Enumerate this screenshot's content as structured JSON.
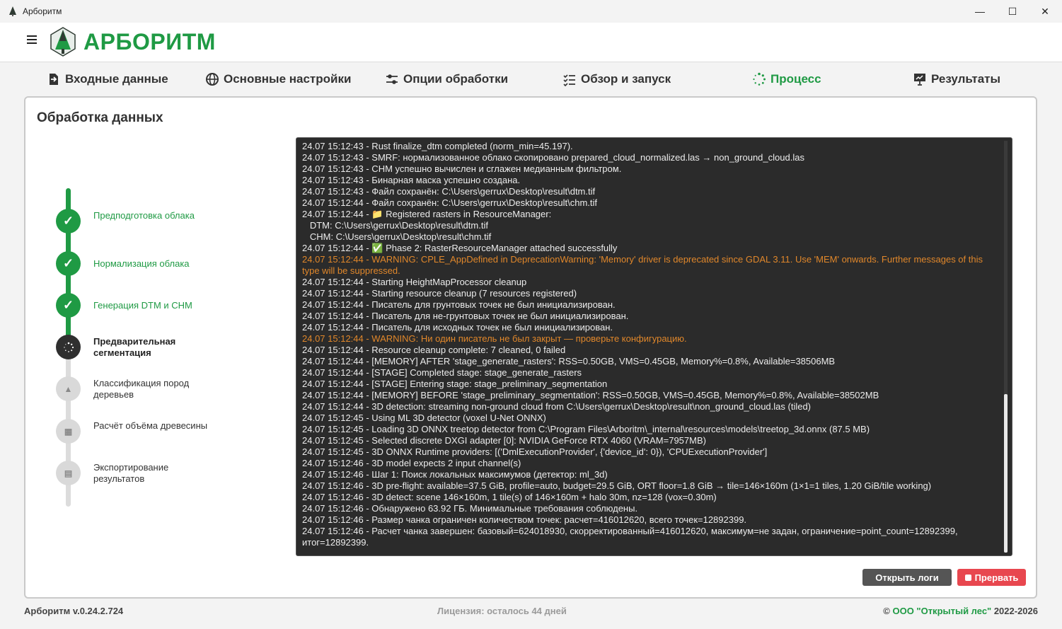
{
  "window": {
    "title": "Арборитм",
    "minimize": "—",
    "maximize": "☐",
    "close": "✕"
  },
  "header": {
    "brand": "АРБОРИТМ"
  },
  "tabs": [
    {
      "label": "Входные данные",
      "icon": "file-import-icon"
    },
    {
      "label": "Основные настройки",
      "icon": "globe-icon"
    },
    {
      "label": "Опции обработки",
      "icon": "sliders-icon"
    },
    {
      "label": "Обзор и запуск",
      "icon": "checklist-icon"
    },
    {
      "label": "Процесс",
      "icon": "spinner-icon",
      "active": true
    },
    {
      "label": "Результаты",
      "icon": "presentation-icon"
    }
  ],
  "panel": {
    "title": "Обработка данных"
  },
  "steps": [
    {
      "label": "Предподготовка облака",
      "state": "done",
      "symbol": "✓"
    },
    {
      "label": "Нормализация облака",
      "state": "done",
      "symbol": "✓"
    },
    {
      "label": "Генерация DTM и CHM",
      "state": "done",
      "symbol": "✓"
    },
    {
      "label": "Предварительная сегментация",
      "state": "current",
      "symbol": ""
    },
    {
      "label": "Классификация пород деревьев",
      "state": "pending",
      "symbol": "▲"
    },
    {
      "label": "Расчёт объёма древесины",
      "state": "pending",
      "symbol": "▦"
    },
    {
      "label": "Экспортирование результатов",
      "state": "pending",
      "symbol": "▤"
    }
  ],
  "log": {
    "lines": [
      {
        "text": "24.07 15:12:43 - Rust finalize_dtm completed (norm_min=45.197).",
        "level": "info"
      },
      {
        "text": "24.07 15:12:43 - SMRF: нормализованное облако скопировано prepared_cloud_normalized.las → non_ground_cloud.las",
        "level": "info"
      },
      {
        "text": "24.07 15:12:43 - CHM успешно вычислен и сглажен медианным фильтром.",
        "level": "info"
      },
      {
        "text": "24.07 15:12:43 - Бинарная маска успешно создана.",
        "level": "info"
      },
      {
        "text": "24.07 15:12:43 - Файл сохранён: C:\\Users\\gerrux\\Desktop\\result\\dtm.tif",
        "level": "info"
      },
      {
        "text": "24.07 15:12:44 - Файл сохранён: C:\\Users\\gerrux\\Desktop\\result\\chm.tif",
        "level": "info"
      },
      {
        "text": "24.07 15:12:44 - 📁 Registered rasters in ResourceManager:",
        "level": "info"
      },
      {
        "text": "   DTM: C:\\Users\\gerrux\\Desktop\\result\\dtm.tif",
        "level": "info"
      },
      {
        "text": "   CHM: C:\\Users\\gerrux\\Desktop\\result\\chm.tif",
        "level": "info"
      },
      {
        "text": "24.07 15:12:44 - ✅ Phase 2: RasterResourceManager attached successfully",
        "level": "info"
      },
      {
        "text": "24.07 15:12:44 - WARNING: CPLE_AppDefined in DeprecationWarning: 'Memory' driver is deprecated since GDAL 3.11. Use 'MEM' onwards. Further messages of this type will be suppressed.",
        "level": "warn"
      },
      {
        "text": "24.07 15:12:44 - Starting HeightMapProcessor cleanup",
        "level": "info"
      },
      {
        "text": "24.07 15:12:44 - Starting resource cleanup (7 resources registered)",
        "level": "info"
      },
      {
        "text": "24.07 15:12:44 - Писатель для грунтовых точек не был инициализирован.",
        "level": "info"
      },
      {
        "text": "24.07 15:12:44 - Писатель для не-грунтовых точек не был инициализирован.",
        "level": "info"
      },
      {
        "text": "24.07 15:12:44 - Писатель для исходных точек не был инициализирован.",
        "level": "info"
      },
      {
        "text": "24.07 15:12:44 - WARNING: Ни один писатель не был закрыт — проверьте конфигурацию.",
        "level": "warn"
      },
      {
        "text": "24.07 15:12:44 - Resource cleanup complete: 7 cleaned, 0 failed",
        "level": "info"
      },
      {
        "text": "24.07 15:12:44 - [MEMORY] AFTER 'stage_generate_rasters': RSS=0.50GB, VMS=0.45GB, Memory%=0.8%, Available=38506MB",
        "level": "info"
      },
      {
        "text": "24.07 15:12:44 - [STAGE] Completed stage: stage_generate_rasters",
        "level": "info"
      },
      {
        "text": "24.07 15:12:44 - [STAGE] Entering stage: stage_preliminary_segmentation",
        "level": "info"
      },
      {
        "text": "24.07 15:12:44 - [MEMORY] BEFORE 'stage_preliminary_segmentation': RSS=0.50GB, VMS=0.45GB, Memory%=0.8%, Available=38502MB",
        "level": "info"
      },
      {
        "text": "24.07 15:12:44 - 3D detection: streaming non-ground cloud from C:\\Users\\gerrux\\Desktop\\result\\non_ground_cloud.las (tiled)",
        "level": "info"
      },
      {
        "text": "24.07 15:12:45 - Using ML 3D detector (voxel U-Net ONNX)",
        "level": "info"
      },
      {
        "text": "24.07 15:12:45 - Loading 3D ONNX treetop detector from C:\\Program Files\\Arboritm\\_internal\\resources\\models\\treetop_3d.onnx (87.5 MB)",
        "level": "info"
      },
      {
        "text": "24.07 15:12:45 - Selected discrete DXGI adapter [0]: NVIDIA GeForce RTX 4060 (VRAM=7957MB)",
        "level": "info"
      },
      {
        "text": "24.07 15:12:45 - 3D ONNX Runtime providers: [('DmlExecutionProvider', {'device_id': 0}), 'CPUExecutionProvider']",
        "level": "info"
      },
      {
        "text": "24.07 15:12:46 - 3D model expects 2 input channel(s)",
        "level": "info"
      },
      {
        "text": "24.07 15:12:46 - Шаг 1: Поиск локальных максимумов (детектор: ml_3d)",
        "level": "info"
      },
      {
        "text": "24.07 15:12:46 - 3D pre-flight: available=37.5 GiB, profile=auto, budget=29.5 GiB, ORT floor=1.8 GiB → tile=146×160m (1×1=1 tiles, 1.20 GiB/tile working)",
        "level": "info"
      },
      {
        "text": "24.07 15:12:46 - 3D detect: scene 146×160m, 1 tile(s) of 146×160m + halo 30m, nz=128 (vox=0.30m)",
        "level": "info"
      },
      {
        "text": "24.07 15:12:46 - Обнаружено 63.92 ГБ. Минимальные требования соблюдены.",
        "level": "info"
      },
      {
        "text": "24.07 15:12:46 - Размер чанка ограничен количеством точек: расчет=416012620, всего точек=12892399.",
        "level": "info"
      },
      {
        "text": "24.07 15:12:46 - Расчет чанка завершен: базовый=624018930, скорректированный=416012620, максимум=не задан, ограничение=point_count=12892399, итог=12892399.",
        "level": "info"
      }
    ]
  },
  "buttons": {
    "open_logs": "Открыть логи",
    "stop": "Прервать"
  },
  "footer": {
    "version": "Арборитм v.0.24.2.724",
    "license": "Лицензия: осталось 44 дней",
    "copyright_prefix": "© ",
    "org": "ООО \"Открытый лес\"",
    "years": " 2022-2026"
  },
  "colors": {
    "accent": "#1f9a44",
    "warn": "#e0872b",
    "stop": "#e8474f",
    "log_bg": "#2b2b2b"
  }
}
